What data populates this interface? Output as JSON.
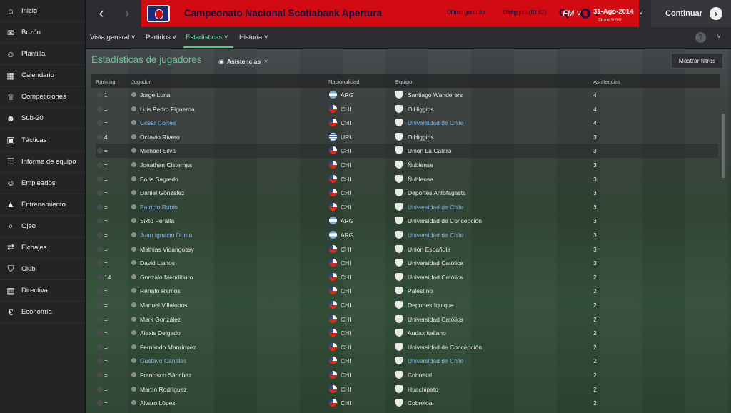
{
  "sidebar": {
    "items": [
      {
        "label": "Inicio",
        "icon": "home-icon"
      },
      {
        "label": "Buzón",
        "icon": "inbox-icon"
      },
      {
        "label": "Plantilla",
        "icon": "squad-icon"
      },
      {
        "label": "Calendario",
        "icon": "calendar-icon"
      },
      {
        "label": "Competiciones",
        "icon": "trophy-icon"
      },
      {
        "label": "Sub-20",
        "icon": "youth-icon"
      },
      {
        "label": "Tácticas",
        "icon": "tactics-icon"
      },
      {
        "label": "Informe de equipo",
        "icon": "report-icon"
      },
      {
        "label": "Empleados",
        "icon": "staff-icon"
      },
      {
        "label": "Entrenamiento",
        "icon": "training-icon"
      },
      {
        "label": "Ojeo",
        "icon": "scouting-icon"
      },
      {
        "label": "Fichajes",
        "icon": "transfers-icon"
      },
      {
        "label": "Club",
        "icon": "club-icon"
      },
      {
        "label": "Directiva",
        "icon": "board-icon"
      },
      {
        "label": "Economía",
        "icon": "finance-icon"
      }
    ]
  },
  "header": {
    "competition_title": "Campeonato Nacional Scotiabank Apertura",
    "last_winner_label": "Último ganador",
    "last_winner_value": "O'Higgins (ID 82)",
    "fm_label": "FM",
    "date": "31-Ago-2014",
    "day_time": "Dom 9:00",
    "continue_label": "Continuar",
    "accent_color": "#d20a11"
  },
  "subnav": {
    "tabs": [
      {
        "label": "Vista general",
        "active": false
      },
      {
        "label": "Partidos",
        "active": false
      },
      {
        "label": "Estadísticas",
        "active": true
      },
      {
        "label": "Historia",
        "active": false
      }
    ],
    "help_label": "?"
  },
  "main": {
    "title": "Estadísticas de jugadores",
    "view_label": "Asistencias",
    "filters_button": "Mostrar filtros",
    "columns": [
      "Ranking",
      "Jugador",
      "Nacionalidad",
      "Equipo",
      "Asistencias"
    ],
    "rows": [
      {
        "rank": "1",
        "player": "Jorge Luna",
        "nat": "ARG",
        "team": "Santiago Wanderers",
        "assists": "4",
        "own_club": false
      },
      {
        "rank": "=",
        "player": "Luis Pedro Figueroa",
        "nat": "CHI",
        "team": "O'Higgins",
        "assists": "4",
        "own_club": false
      },
      {
        "rank": "=",
        "player": "César Cortés",
        "nat": "CHI",
        "team": "Universidad de Chile",
        "assists": "4",
        "own_club": true
      },
      {
        "rank": "4",
        "player": "Octavio Rivero",
        "nat": "URU",
        "team": "O'Higgins",
        "assists": "3",
        "own_club": false
      },
      {
        "rank": "=",
        "player": "Michael Silva",
        "nat": "CHI",
        "team": "Unión La Calera",
        "assists": "3",
        "own_club": false
      },
      {
        "rank": "=",
        "player": "Jonathan Cisternas",
        "nat": "CHI",
        "team": "Ñublense",
        "assists": "3",
        "own_club": false
      },
      {
        "rank": "=",
        "player": "Boris Sagredo",
        "nat": "CHI",
        "team": "Ñublense",
        "assists": "3",
        "own_club": false
      },
      {
        "rank": "=",
        "player": "Daniel González",
        "nat": "CHI",
        "team": "Deportes Antofagasta",
        "assists": "3",
        "own_club": false
      },
      {
        "rank": "=",
        "player": "Patricio Rubio",
        "nat": "CHI",
        "team": "Universidad de Chile",
        "assists": "3",
        "own_club": true
      },
      {
        "rank": "=",
        "player": "Sixto Peralta",
        "nat": "ARG",
        "team": "Universidad de Concepción",
        "assists": "3",
        "own_club": false
      },
      {
        "rank": "=",
        "player": "Juan Ignacio Duma",
        "nat": "ARG",
        "team": "Universidad de Chile",
        "assists": "3",
        "own_club": true
      },
      {
        "rank": "=",
        "player": "Mathias Vidangossy",
        "nat": "CHI",
        "team": "Unión Española",
        "assists": "3",
        "own_club": false
      },
      {
        "rank": "=",
        "player": "David Llanos",
        "nat": "CHI",
        "team": "Universidad Católica",
        "assists": "3",
        "own_club": false
      },
      {
        "rank": "14",
        "player": "Gonzalo Mendiburo",
        "nat": "CHI",
        "team": "Universidad Católica",
        "assists": "2",
        "own_club": false
      },
      {
        "rank": "=",
        "player": "Renato Ramos",
        "nat": "CHI",
        "team": "Palestino",
        "assists": "2",
        "own_club": false
      },
      {
        "rank": "=",
        "player": "Manuel Villalobos",
        "nat": "CHI",
        "team": "Deportes Iquique",
        "assists": "2",
        "own_club": false
      },
      {
        "rank": "=",
        "player": "Mark González",
        "nat": "CHI",
        "team": "Universidad Católica",
        "assists": "2",
        "own_club": false
      },
      {
        "rank": "=",
        "player": "Alexis Delgado",
        "nat": "CHI",
        "team": "Audax Italiano",
        "assists": "2",
        "own_club": false
      },
      {
        "rank": "=",
        "player": "Fernando Manríquez",
        "nat": "CHI",
        "team": "Universidad de Concepción",
        "assists": "2",
        "own_club": false
      },
      {
        "rank": "=",
        "player": "Gustavo Canales",
        "nat": "CHI",
        "team": "Universidad de Chile",
        "assists": "2",
        "own_club": true
      },
      {
        "rank": "=",
        "player": "Francisco Sánchez",
        "nat": "CHI",
        "team": "Cobresal",
        "assists": "2",
        "own_club": false
      },
      {
        "rank": "=",
        "player": "Martín Rodríguez",
        "nat": "CHI",
        "team": "Huachipato",
        "assists": "2",
        "own_club": false
      },
      {
        "rank": "=",
        "player": "Alvaro López",
        "nat": "CHI",
        "team": "Cobreloa",
        "assists": "2",
        "own_club": false
      }
    ],
    "highlighted_row": 4
  }
}
